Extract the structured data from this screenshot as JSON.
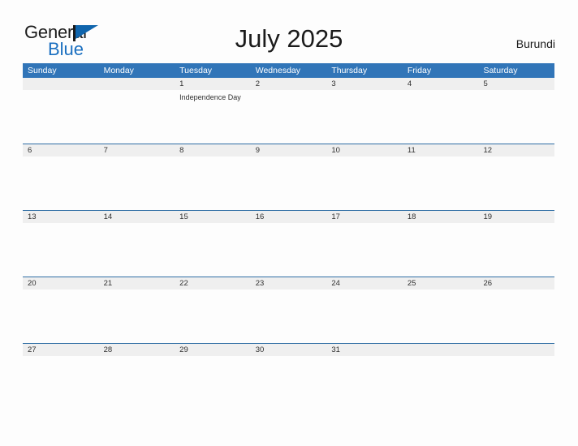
{
  "brand": {
    "name_part1": "General",
    "name_part2": "Blue",
    "flag_icon": "flag-icon"
  },
  "header": {
    "title": "July 2025",
    "country": "Burundi"
  },
  "calendar": {
    "weekdays": [
      "Sunday",
      "Monday",
      "Tuesday",
      "Wednesday",
      "Thursday",
      "Friday",
      "Saturday"
    ],
    "colors": {
      "header_blue": "#3175b8",
      "row_divider_blue": "#2e6da4",
      "number_band_gray": "#efefef",
      "text_dark": "#303030",
      "brand_blue": "#1a6fc0"
    },
    "weeks": [
      {
        "days": [
          {
            "num": "",
            "events": []
          },
          {
            "num": "",
            "events": []
          },
          {
            "num": "1",
            "events": [
              "Independence Day"
            ]
          },
          {
            "num": "2",
            "events": []
          },
          {
            "num": "3",
            "events": []
          },
          {
            "num": "4",
            "events": []
          },
          {
            "num": "5",
            "events": []
          }
        ]
      },
      {
        "days": [
          {
            "num": "6",
            "events": []
          },
          {
            "num": "7",
            "events": []
          },
          {
            "num": "8",
            "events": []
          },
          {
            "num": "9",
            "events": []
          },
          {
            "num": "10",
            "events": []
          },
          {
            "num": "11",
            "events": []
          },
          {
            "num": "12",
            "events": []
          }
        ]
      },
      {
        "days": [
          {
            "num": "13",
            "events": []
          },
          {
            "num": "14",
            "events": []
          },
          {
            "num": "15",
            "events": []
          },
          {
            "num": "16",
            "events": []
          },
          {
            "num": "17",
            "events": []
          },
          {
            "num": "18",
            "events": []
          },
          {
            "num": "19",
            "events": []
          }
        ]
      },
      {
        "days": [
          {
            "num": "20",
            "events": []
          },
          {
            "num": "21",
            "events": []
          },
          {
            "num": "22",
            "events": []
          },
          {
            "num": "23",
            "events": []
          },
          {
            "num": "24",
            "events": []
          },
          {
            "num": "25",
            "events": []
          },
          {
            "num": "26",
            "events": []
          }
        ]
      },
      {
        "days": [
          {
            "num": "27",
            "events": []
          },
          {
            "num": "28",
            "events": []
          },
          {
            "num": "29",
            "events": []
          },
          {
            "num": "30",
            "events": []
          },
          {
            "num": "31",
            "events": []
          },
          {
            "num": "",
            "events": []
          },
          {
            "num": "",
            "events": []
          }
        ]
      }
    ]
  }
}
